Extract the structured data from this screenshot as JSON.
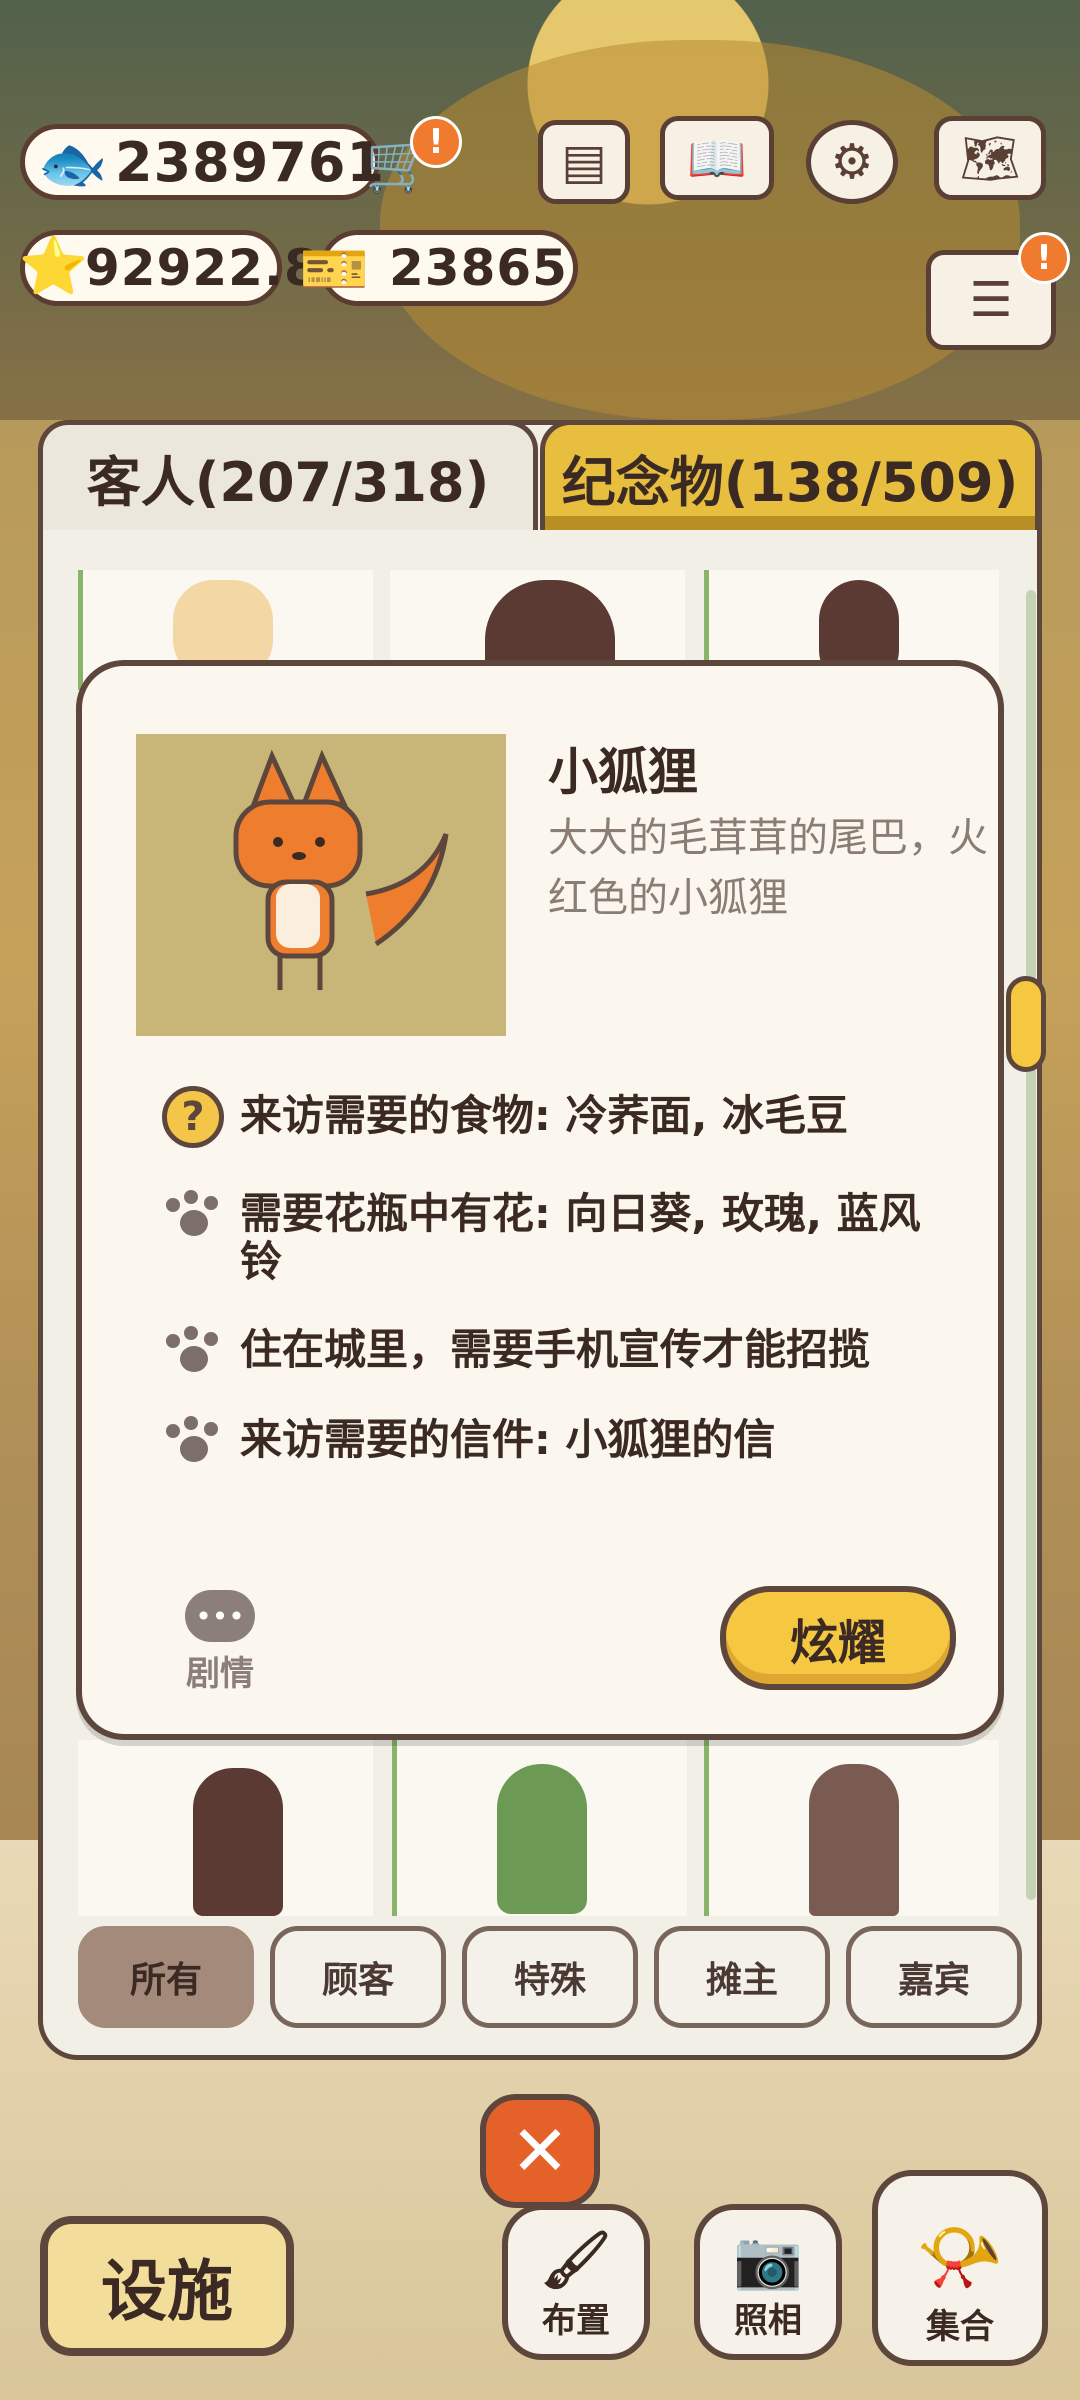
{
  "currency": {
    "fish": "2389761",
    "stars": "92922.8",
    "tickets": "23865",
    "cart_badge": "!",
    "menu_badge": "!"
  },
  "tabs": {
    "guests": "客人(207/318)",
    "souvenirs": "纪念物(138/509)"
  },
  "guest_detail": {
    "name": "小狐狸",
    "description": "大大的毛茸茸的尾巴，火红色的小狐狸",
    "requirements": [
      {
        "icon": "question-icon",
        "text": "来访需要的食物: 冷荞面, 冰毛豆"
      },
      {
        "icon": "paw-icon",
        "text": "需要花瓶中有花: 向日葵, 玫瑰, 蓝风铃"
      },
      {
        "icon": "paw-icon",
        "text": "住在城里，需要手机宣传才能招揽"
      },
      {
        "icon": "paw-icon",
        "text": "来访需要的信件: 小狐狸的信"
      }
    ],
    "story_label": "剧情",
    "show_button": "炫耀"
  },
  "filters": [
    "所有",
    "顾客",
    "特殊",
    "摊主",
    "嘉宾"
  ],
  "bottom_bar": {
    "close": "✕",
    "facility": "设施",
    "layout": "布置",
    "photo": "照相",
    "gather": "集合"
  },
  "colors": {
    "accent_yellow": "#f6c741",
    "border_brown": "#5d463c",
    "badge_orange": "#f07b2f",
    "close_red": "#e4622a"
  }
}
